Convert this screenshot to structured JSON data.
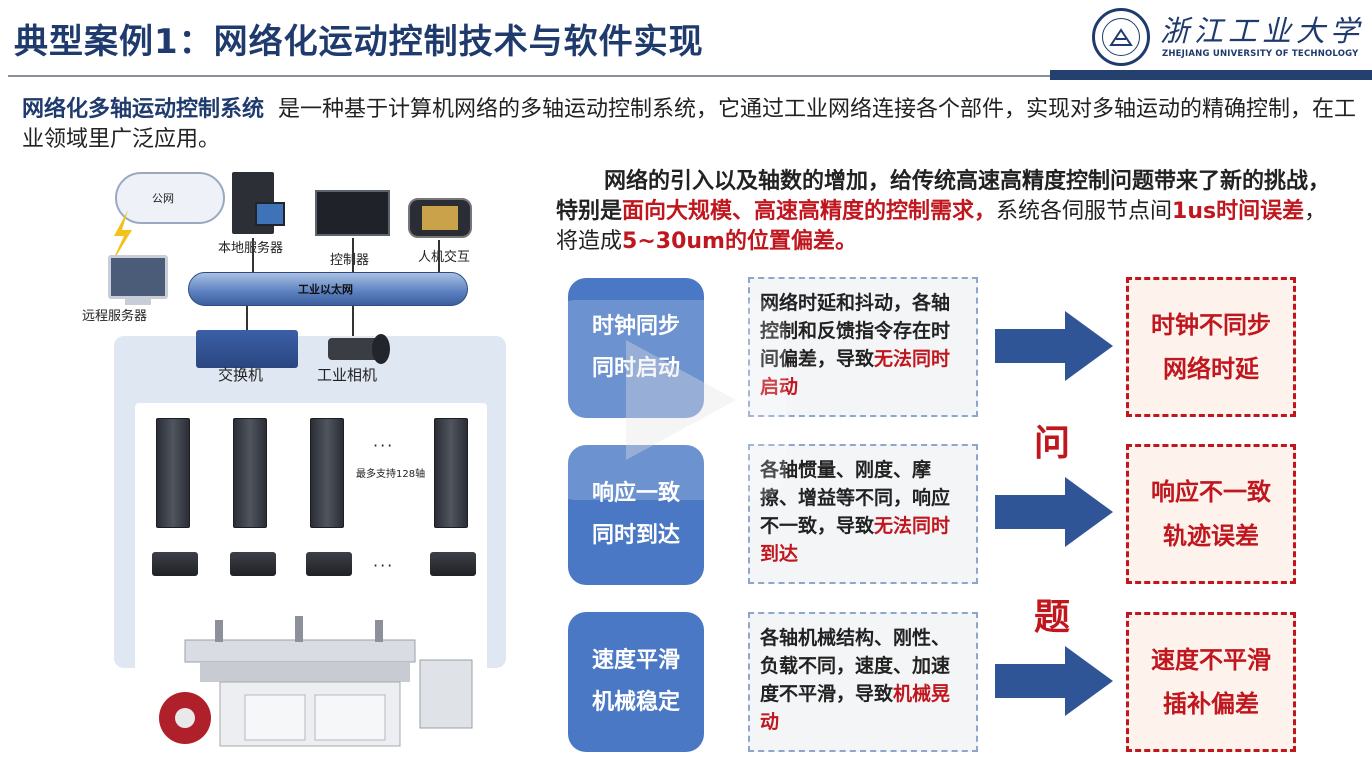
{
  "header": {
    "title": "典型案例1：网络化运动控制技术与软件实现",
    "logo_cn": "浙江工业大学",
    "logo_en": "ZHEJIANG UNIVERSITY OF TECHNOLOGY"
  },
  "intro": {
    "highlight": "网络化多轴运动控制系统",
    "text": "是一种基于计算机网络的多轴运动控制系统，它通过工业网络连接各个部件，实现对多轴运动的精确控制，在工业领域里广泛应用。"
  },
  "diagram": {
    "cloud": "公网",
    "local_server": "本地服务器",
    "controller": "控制器",
    "hmi": "人机交互",
    "remote_server": "远程服务器",
    "ethernet": "工业以太网",
    "switch": "交换机",
    "camera": "工业相机",
    "max_axes": "最多支持128轴",
    "ellipsis": "···"
  },
  "challenge": {
    "p1": "网络的引入以及轴数的增加，给传统高速高精度控制问题带来了新的挑战，特别是",
    "p1_red": "面向大规模、高速高精度的控制需求，",
    "p2": "系统各伺服节点间",
    "p2_red": "1us时间误差",
    "p3": "，将造成",
    "p3_red": "5~30um的位置偏差。"
  },
  "rows": [
    {
      "pill_1": "时钟同步",
      "pill_2": "同时启动",
      "desc": "网络时延和抖动，各轴控制和反馈指令存在时间偏差，导致",
      "desc_red": "无法同时启动",
      "res_1": "时钟不同步",
      "res_2": "网络时延"
    },
    {
      "pill_1": "响应一致",
      "pill_2": "同时到达",
      "desc": "各轴惯量、刚度、摩擦、增益等不同，响应不一致，导致",
      "desc_red": "无法同时到达",
      "res_1": "响应不一致",
      "res_2": "轨迹误差"
    },
    {
      "pill_1": "速度平滑",
      "pill_2": "机械稳定",
      "desc": "各轴机械结构、刚性、负载不同，速度、加速度不平滑，导致",
      "desc_red": "机械晃动",
      "res_1": "速度不平滑",
      "res_2": "插补偏差"
    }
  ],
  "question": {
    "c1": "问",
    "c2": "题"
  },
  "colors": {
    "navy": "#1f3b6e",
    "pill": "#4a78c5",
    "arrow": "#2f5597",
    "red": "#c0171f"
  }
}
